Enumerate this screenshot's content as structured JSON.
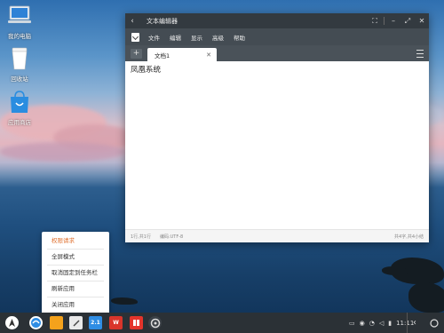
{
  "desktop": {
    "icons": [
      {
        "label": "我的电脑",
        "icon": "computer-icon"
      },
      {
        "label": "回收站",
        "icon": "trash-icon"
      },
      {
        "label": "应用商店",
        "icon": "app-store-icon"
      }
    ]
  },
  "window": {
    "title": "文本编辑器",
    "menus": [
      "文件",
      "编辑",
      "显示",
      "高级",
      "帮助"
    ],
    "tab_label": "文档1",
    "content": "凤凰系统",
    "status": {
      "position": "1行,共1行",
      "encoding": "编码:UTF-8",
      "count": "共4字,共4小结"
    }
  },
  "context_menu": {
    "items": [
      "权限请求",
      "全屏模式",
      "取消固定到任务栏",
      "刷新应用",
      "关闭应用"
    ]
  },
  "taskbar": {
    "apps": [
      "start-icon",
      "browser-icon",
      "files-icon",
      "text-editor-icon",
      "calendar-icon",
      "wps-icon",
      "office-icon",
      "settings-icon"
    ],
    "calendar_label": "2.1",
    "clock": "11:11"
  },
  "colors": {
    "titlebar": "#333a40",
    "menubar": "#444c53",
    "accent": "#e0702e",
    "taskbar": "#2b3136"
  }
}
